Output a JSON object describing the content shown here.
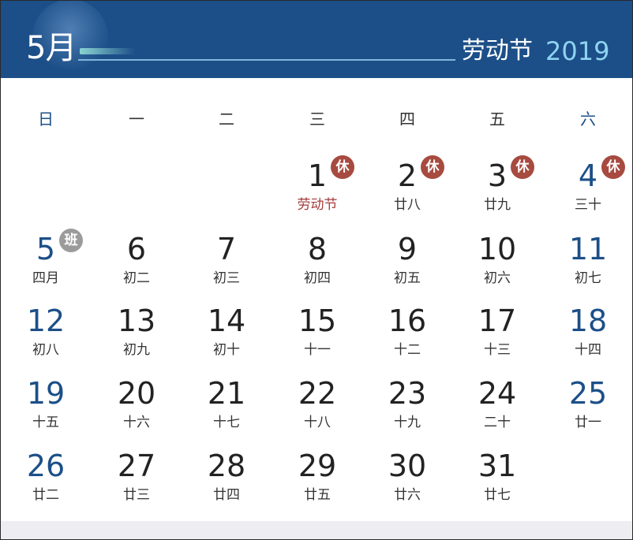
{
  "header": {
    "month": "5月",
    "holiday_title": "劳动节",
    "year": "2019"
  },
  "colors": {
    "header_bg": "#1c4f88",
    "weekend_number": "#1c4f88",
    "rest_badge": "#a74a40",
    "work_badge": "#9b9b9b",
    "festival_text": "#a43b3b"
  },
  "weekdays": [
    "日",
    "一",
    "二",
    "三",
    "四",
    "五",
    "六"
  ],
  "weeks": [
    [
      null,
      null,
      null,
      {
        "day": "1",
        "sub": "劳动节",
        "badge": "休",
        "badge_type": "rest",
        "festival": true
      },
      {
        "day": "2",
        "sub": "廿八",
        "badge": "休",
        "badge_type": "rest"
      },
      {
        "day": "3",
        "sub": "廿九",
        "badge": "休",
        "badge_type": "rest"
      },
      {
        "day": "4",
        "sub": "三十",
        "badge": "休",
        "badge_type": "rest"
      }
    ],
    [
      {
        "day": "5",
        "sub": "四月",
        "badge": "班",
        "badge_type": "work"
      },
      {
        "day": "6",
        "sub": "初二"
      },
      {
        "day": "7",
        "sub": "初三"
      },
      {
        "day": "8",
        "sub": "初四"
      },
      {
        "day": "9",
        "sub": "初五"
      },
      {
        "day": "10",
        "sub": "初六"
      },
      {
        "day": "11",
        "sub": "初七"
      }
    ],
    [
      {
        "day": "12",
        "sub": "初八"
      },
      {
        "day": "13",
        "sub": "初九"
      },
      {
        "day": "14",
        "sub": "初十"
      },
      {
        "day": "15",
        "sub": "十一"
      },
      {
        "day": "16",
        "sub": "十二"
      },
      {
        "day": "17",
        "sub": "十三"
      },
      {
        "day": "18",
        "sub": "十四"
      }
    ],
    [
      {
        "day": "19",
        "sub": "十五"
      },
      {
        "day": "20",
        "sub": "十六"
      },
      {
        "day": "21",
        "sub": "十七"
      },
      {
        "day": "22",
        "sub": "十八"
      },
      {
        "day": "23",
        "sub": "十九"
      },
      {
        "day": "24",
        "sub": "二十"
      },
      {
        "day": "25",
        "sub": "廿一"
      }
    ],
    [
      {
        "day": "26",
        "sub": "廿二"
      },
      {
        "day": "27",
        "sub": "廿三"
      },
      {
        "day": "28",
        "sub": "廿四"
      },
      {
        "day": "29",
        "sub": "廿五"
      },
      {
        "day": "30",
        "sub": "廿六"
      },
      {
        "day": "31",
        "sub": "廿七"
      },
      null
    ]
  ]
}
